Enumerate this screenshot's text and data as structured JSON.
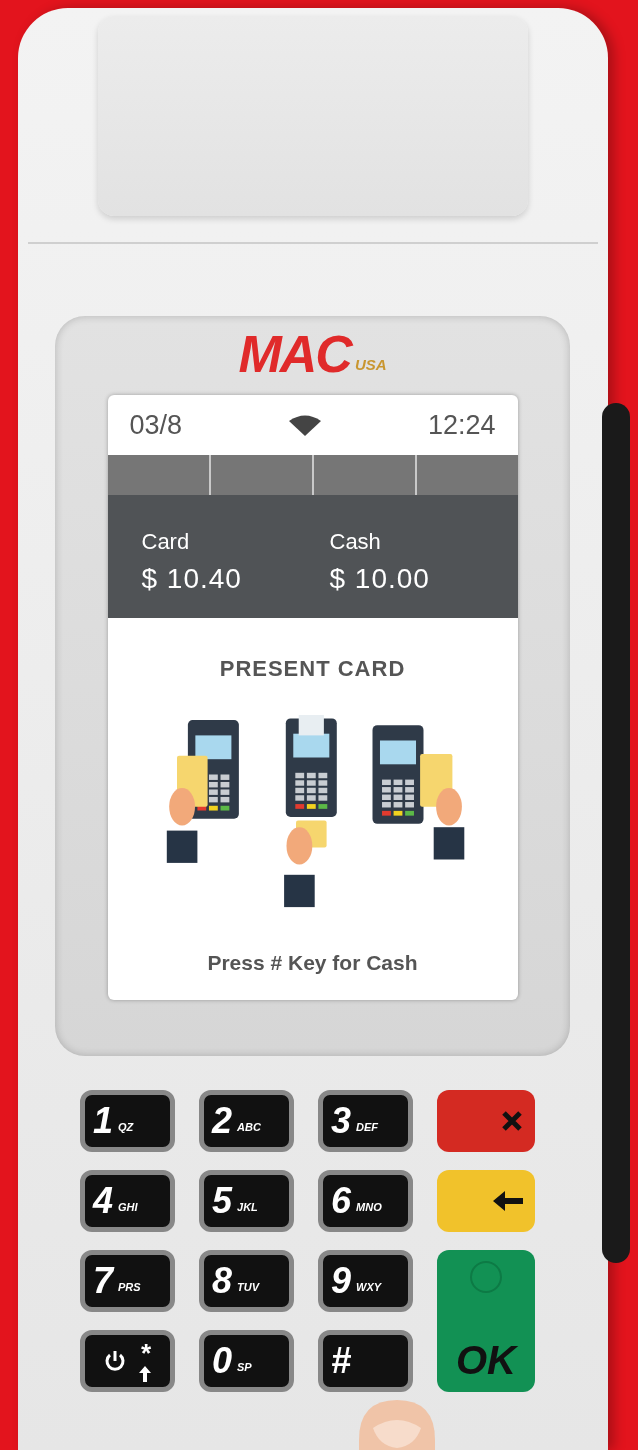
{
  "device": {
    "logo": {
      "name": "MAC",
      "sub": "USA"
    }
  },
  "status_bar": {
    "date": "03/8",
    "time": "12:24"
  },
  "amounts": [
    {
      "label": "Card",
      "value": "$ 10.40"
    },
    {
      "label": "Cash",
      "value": "$ 10.00"
    }
  ],
  "prompt": "PRESENT CARD",
  "hint": "Press # Key for Cash",
  "keypad": [
    {
      "kind": "digit",
      "main": "1",
      "sub": "QZ"
    },
    {
      "kind": "digit",
      "main": "2",
      "sub": "ABC"
    },
    {
      "kind": "digit",
      "main": "3",
      "sub": "DEF"
    },
    {
      "kind": "cancel"
    },
    {
      "kind": "digit",
      "main": "4",
      "sub": "GHI"
    },
    {
      "kind": "digit",
      "main": "5",
      "sub": "JKL"
    },
    {
      "kind": "digit",
      "main": "6",
      "sub": "MNO"
    },
    {
      "kind": "clear"
    },
    {
      "kind": "digit",
      "main": "7",
      "sub": "PRS"
    },
    {
      "kind": "digit",
      "main": "8",
      "sub": "TUV"
    },
    {
      "kind": "digit",
      "main": "9",
      "sub": "WXY"
    },
    {
      "kind": "power",
      "main": "*"
    },
    {
      "kind": "digit",
      "main": "0",
      "sub": "SP"
    },
    {
      "kind": "digit",
      "main": "#"
    },
    {
      "kind": "enter",
      "main": "OK"
    }
  ]
}
